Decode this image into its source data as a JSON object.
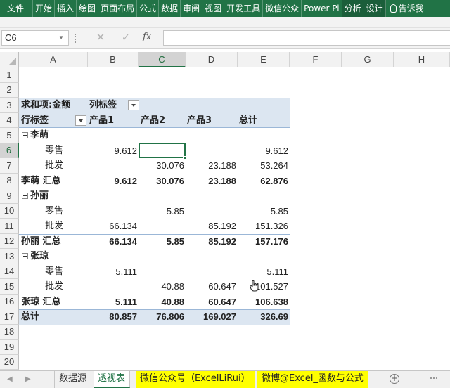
{
  "ribbon": {
    "tabs": [
      "文件",
      "开始",
      "插入",
      "绘图",
      "页面布局",
      "公式",
      "数据",
      "审阅",
      "视图",
      "开发工具",
      "微信公众",
      "Power Pi",
      "分析",
      "设计"
    ],
    "tell_me": "告诉我"
  },
  "formula_bar": {
    "name_box": "C6",
    "cancel_icon": "✕",
    "enter_icon": "✓",
    "fx": "fx",
    "formula": ""
  },
  "columns": [
    "A",
    "B",
    "C",
    "D",
    "E",
    "F",
    "G",
    "H"
  ],
  "rows": [
    "1",
    "2",
    "3",
    "4",
    "5",
    "6",
    "7",
    "8",
    "9",
    "10",
    "11",
    "12",
    "13",
    "14",
    "15",
    "16",
    "17",
    "18",
    "19",
    "20"
  ],
  "pivot": {
    "r3": {
      "a": "求和项:金额",
      "b": "列标签"
    },
    "r4": {
      "a": "行标签",
      "b": "产品1",
      "c": "产品2",
      "d": "产品3",
      "e": "总计"
    },
    "r5": {
      "a": "李萌"
    },
    "r6": {
      "a": "零售",
      "b": "9.612",
      "c": "",
      "d": "",
      "e": "9.612"
    },
    "r7": {
      "a": "批发",
      "b": "",
      "c": "30.076",
      "d": "23.188",
      "e": "53.264"
    },
    "r8": {
      "a": "李萌 汇总",
      "b": "9.612",
      "c": "30.076",
      "d": "23.188",
      "e": "62.876"
    },
    "r9": {
      "a": "孙丽"
    },
    "r10": {
      "a": "零售",
      "b": "",
      "c": "5.85",
      "d": "",
      "e": "5.85"
    },
    "r11": {
      "a": "批发",
      "b": "66.134",
      "c": "",
      "d": "85.192",
      "e": "151.326"
    },
    "r12": {
      "a": "孙丽 汇总",
      "b": "66.134",
      "c": "5.85",
      "d": "85.192",
      "e": "157.176"
    },
    "r13": {
      "a": "张琼"
    },
    "r14": {
      "a": "零售",
      "b": "5.111",
      "c": "",
      "d": "",
      "e": "5.111"
    },
    "r15": {
      "a": "批发",
      "b": "",
      "c": "40.88",
      "d": "60.647",
      "e": "101.527"
    },
    "r16": {
      "a": "张琼 汇总",
      "b": "5.111",
      "c": "40.88",
      "d": "60.647",
      "e": "106.638"
    },
    "r17": {
      "a": "总计",
      "b": "80.857",
      "c": "76.806",
      "d": "169.027",
      "e": "326.69"
    }
  },
  "sheet_tabs": [
    "数据源",
    "透视表",
    "微信公众号（ExcelLiRui）",
    "微博@Excel_函数与公式"
  ],
  "colors": {
    "accent": "#217346",
    "pivot_band": "#dce6f1",
    "tab_highlight": "#ffff00"
  }
}
